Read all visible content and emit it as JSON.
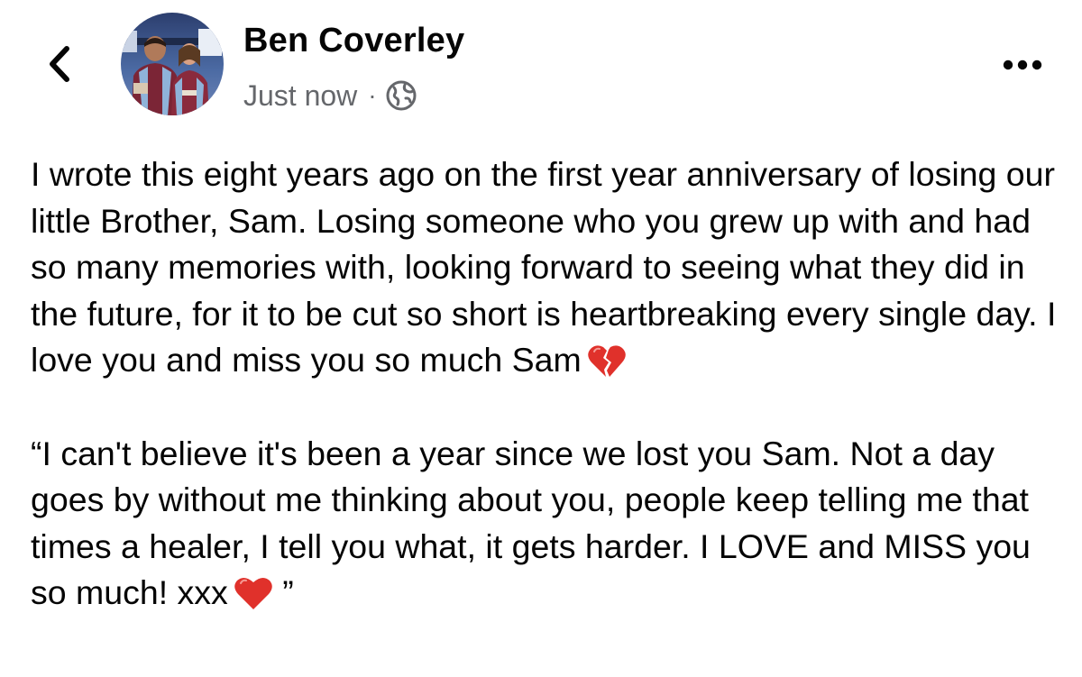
{
  "post": {
    "author_name": "Ben Coverley",
    "timestamp": "Just now",
    "meta_separator": "·",
    "privacy_icon": "globe-icon",
    "paragraph_1": "I wrote this eight years ago on the first year anniversary of losing our little Brother, Sam. Losing someone who you grew up with and had so many memories with, looking forward to seeing what they did in the future, for it to be cut so short is heartbreaking every single day. I love you and miss you so much Sam",
    "paragraph_1_emoji": "broken-heart-emoji",
    "paragraph_2": "“I can't believe it's been a year since we lost you Sam. Not a day goes by without me thinking about you, people keep telling me that times a healer, I tell you what, it gets harder. I LOVE and MISS you so much! xxx",
    "paragraph_2_emoji": "red-heart-emoji",
    "paragraph_2_closing": "”"
  },
  "header": {
    "back_icon": "chevron-left-icon",
    "more_icon": "more-dots-icon"
  },
  "colors": {
    "text_primary": "#050505",
    "text_secondary": "#65676b",
    "heart_red": "#e0312b",
    "background": "#ffffff"
  }
}
